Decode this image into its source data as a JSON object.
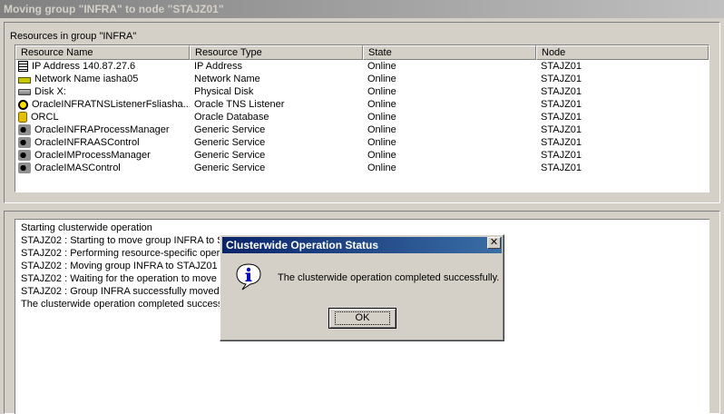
{
  "window": {
    "title": "Moving group \"INFRA\" to node \"STAJZ01\""
  },
  "resources": {
    "group_label": "Resources in group \"INFRA\"",
    "columns": [
      "Resource Name",
      "Resource Type",
      "State",
      "Node"
    ],
    "rows": [
      {
        "icon": "ip-address-icon",
        "name": "IP Address 140.87.27.6",
        "type": "IP Address",
        "state": "Online",
        "node": "STAJZ01"
      },
      {
        "icon": "network-name-icon",
        "name": "Network Name iasha05",
        "type": "Network Name",
        "state": "Online",
        "node": "STAJZ01"
      },
      {
        "icon": "disk-icon",
        "name": "Disk X:",
        "type": "Physical Disk",
        "state": "Online",
        "node": "STAJZ01"
      },
      {
        "icon": "tns-listener-icon",
        "name": "OracleINFRATNSListenerFsliasha...",
        "type": "Oracle TNS Listener",
        "state": "Online",
        "node": "STAJZ01"
      },
      {
        "icon": "database-icon",
        "name": "ORCL",
        "type": "Oracle Database",
        "state": "Online",
        "node": "STAJZ01"
      },
      {
        "icon": "generic-service-icon",
        "name": "OracleINFRAProcessManager",
        "type": "Generic Service",
        "state": "Online",
        "node": "STAJZ01"
      },
      {
        "icon": "generic-service-icon",
        "name": "OracleINFRAASControl",
        "type": "Generic Service",
        "state": "Online",
        "node": "STAJZ01"
      },
      {
        "icon": "generic-service-icon",
        "name": "OracleIMProcessManager",
        "type": "Generic Service",
        "state": "Online",
        "node": "STAJZ01"
      },
      {
        "icon": "generic-service-icon",
        "name": "OracleIMASControl",
        "type": "Generic Service",
        "state": "Online",
        "node": "STAJZ01"
      }
    ]
  },
  "log": {
    "lines": [
      "Starting clusterwide operation",
      "STAJZ02 : Starting to move group INFRA to STAJZ01",
      "STAJZ02 : Performing resource-specific operation",
      "STAJZ02 : Moving group INFRA to STAJZ01",
      "STAJZ02 : Waiting for the operation to move group INFRA",
      "STAJZ02 : Group INFRA successfully moved to STAJZ01",
      "The clusterwide operation completed successfully."
    ]
  },
  "dialog": {
    "title": "Clusterwide Operation Status",
    "close_glyph": "✕",
    "icon": "information-icon",
    "message": "The clusterwide operation completed successfully.",
    "ok_label": "OK"
  }
}
